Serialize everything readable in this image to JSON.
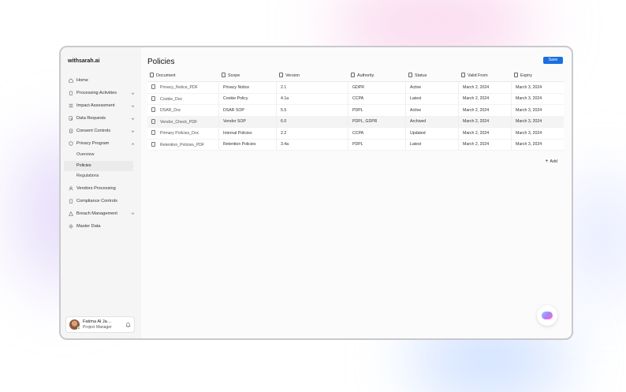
{
  "app": {
    "brand": "withsarah.ai",
    "page_title": "Policies",
    "save_label": "Save",
    "add_label": "Add"
  },
  "sidebar": {
    "items": [
      {
        "label": "Home",
        "icon": "home-icon",
        "chevron": false
      },
      {
        "label": "Processing Activities",
        "icon": "clipboard-icon",
        "chevron": true
      },
      {
        "label": "Impact Assessment",
        "icon": "list-icon",
        "chevron": true
      },
      {
        "label": "Data Requests",
        "icon": "file-search-icon",
        "chevron": true
      },
      {
        "label": "Consent Controls",
        "icon": "clipboard-check-icon",
        "chevron": true
      },
      {
        "label": "Privacy Program",
        "icon": "shield-icon",
        "chevron": true,
        "expanded": true
      }
    ],
    "sub_items": [
      {
        "label": "Overview",
        "active": false
      },
      {
        "label": "Policies",
        "active": true
      },
      {
        "label": "Regulations",
        "active": false
      }
    ],
    "items_after": [
      {
        "label": "Vendors Processing",
        "icon": "user-icon",
        "chevron": false
      },
      {
        "label": "Compliance Controls",
        "icon": "clipboard-icon",
        "chevron": false
      },
      {
        "label": "Breach Management",
        "icon": "alert-icon",
        "chevron": true
      },
      {
        "label": "Master Data",
        "icon": "gear-icon",
        "chevron": false
      }
    ]
  },
  "user": {
    "name": "Fatima Al Ja…",
    "role": "Project Manager"
  },
  "table": {
    "columns": [
      "Document",
      "Scope",
      "Version",
      "Authority",
      "Status",
      "Valid From",
      "Expiry"
    ],
    "rows": [
      [
        "Privacy_Notice_PDF",
        "Privacy Notice",
        "2.1",
        "GDPR",
        "Active",
        "March 2, 2024",
        "March 3, 2024"
      ],
      [
        "Cookie_Doc",
        "Cookie Policy",
        "4.1a",
        "CCPA",
        "Latest",
        "March 2, 2024",
        "March 3, 2024"
      ],
      [
        "DSAR_Doc",
        "DSAR SOP",
        "5.5",
        "PDPL",
        "Active",
        "March 2, 2024",
        "March 3, 2024"
      ],
      [
        "Vendor_Check_PDF",
        "Vendor SOP",
        "6.0",
        "PDPL, GDPR",
        "Archived",
        "March 2, 2024",
        "March 3, 2024"
      ],
      [
        "Primary Policies_Doc",
        "Internal Policies",
        "2.2",
        "CCPA",
        "Updated",
        "March 2, 2024",
        "March 3, 2024"
      ],
      [
        "Retention_Policies_PDF",
        "Retention Policies",
        "3.4a",
        "PDPL",
        "Latest",
        "March 2, 2024",
        "March 3, 2024"
      ]
    ]
  },
  "colors": {
    "accent": "#1a6fe0",
    "online": "#4cc16a"
  }
}
